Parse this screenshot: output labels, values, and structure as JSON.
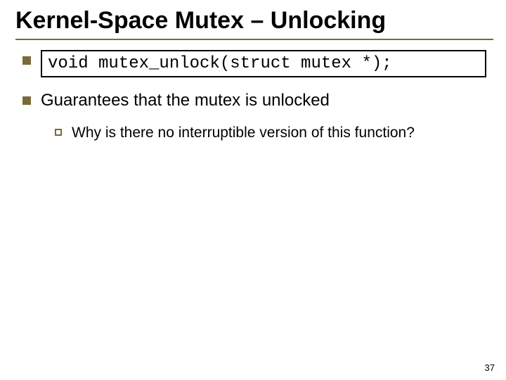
{
  "title": "Kernel-Space Mutex – Unlocking",
  "bullets": [
    {
      "code": "void mutex_unlock(struct mutex *);"
    },
    {
      "text": "Guarantees that the mutex is unlocked",
      "sub": [
        {
          "text": "Why is there no interruptible version of this function?"
        }
      ]
    }
  ],
  "page_number": "37"
}
